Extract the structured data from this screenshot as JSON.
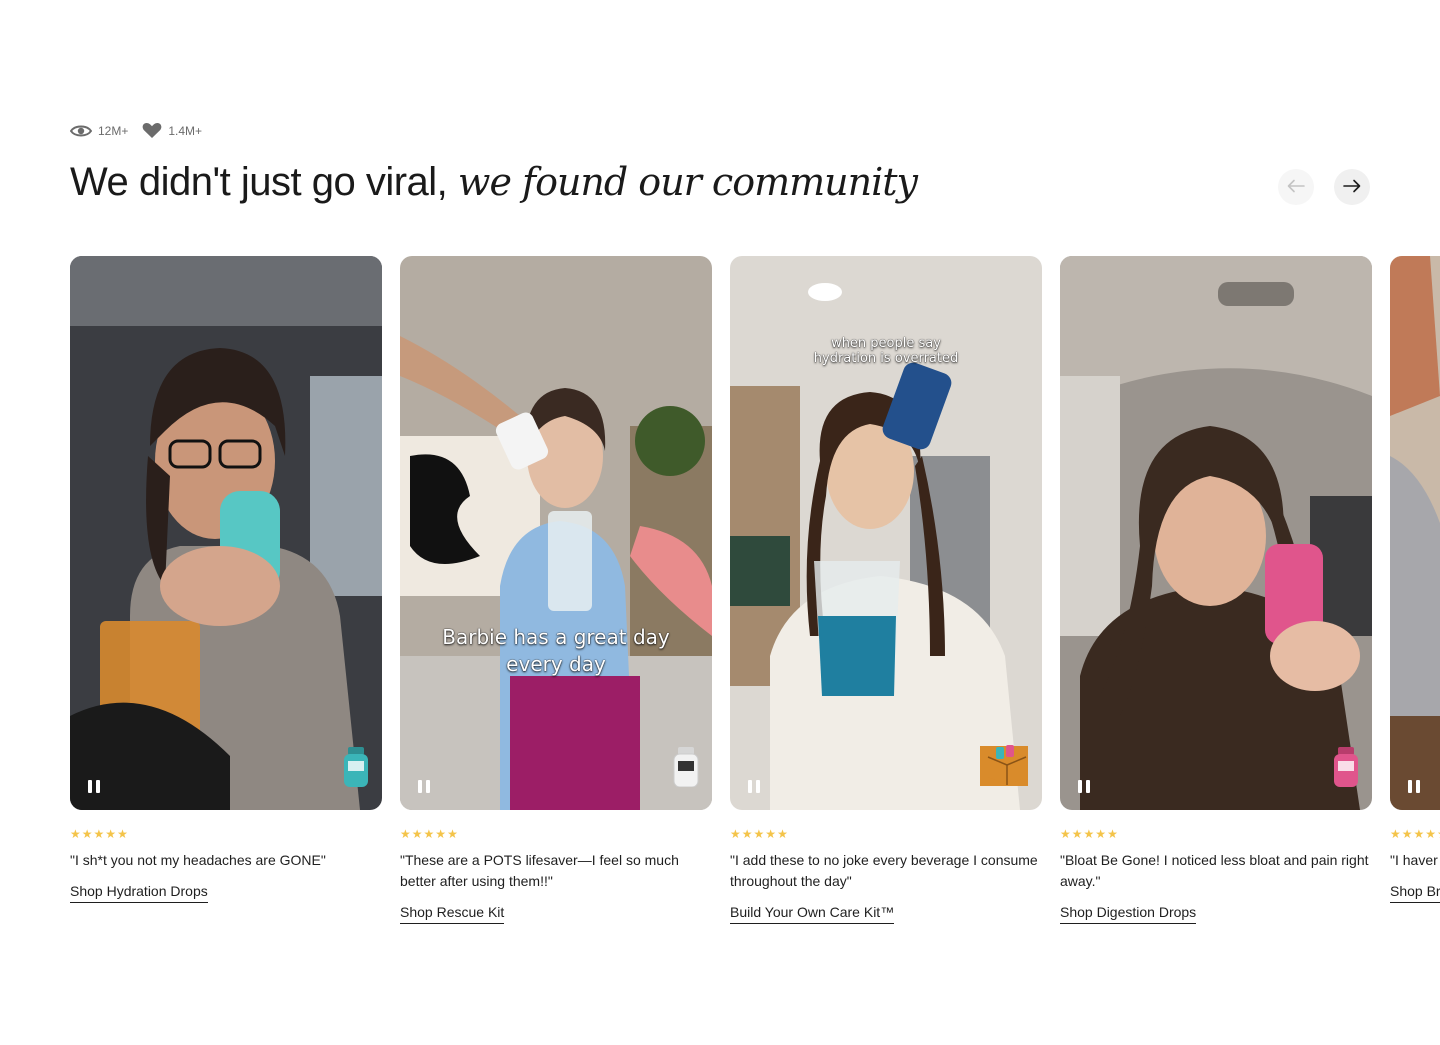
{
  "stats": {
    "views": "12M+",
    "likes": "1.4M+"
  },
  "headline": {
    "regular": "We didn't just go viral, ",
    "italic": "we found our community"
  },
  "colors": {
    "star": "#f4c44a",
    "text": "#1f1f1f",
    "muted": "#6b6b6b"
  },
  "cards": [
    {
      "overlay": "",
      "rating": 5,
      "quote": "\"I sh*t you not my headaches are GONE\"",
      "cta": "Shop Hydration Drops",
      "product_color": "#3bb5b8"
    },
    {
      "overlay": "Barbie has a great day every day",
      "rating": 5,
      "quote": "\"These are a POTS lifesaver—I feel so much better after using them!!\"",
      "cta": "Shop Rescue Kit",
      "product_color": "#f2f2f2"
    },
    {
      "overlay": "when people say hydration is overrated",
      "rating": 5,
      "quote": "\"I add these to no joke every beverage I consume throughout the day\"",
      "cta": "Build Your Own Care Kit™",
      "product_color": "#d98b2b"
    },
    {
      "overlay": "",
      "rating": 5,
      "quote": "\"Bloat Be Gone! I noticed less bloat and pain right away.\"",
      "cta": "Shop Digestion Drops",
      "product_color": "#e0558c"
    },
    {
      "overlay": "",
      "rating": 5,
      "quote": "\"I haver",
      "cta": "Shop Br",
      "product_color": "#9b9b9b"
    }
  ]
}
